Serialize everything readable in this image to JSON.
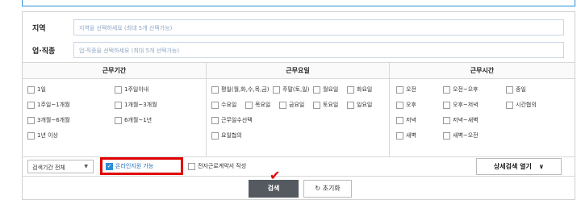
{
  "region": {
    "label": "지역",
    "placeholder": "지역을 선택하세요 (최대 5개 선택가능)"
  },
  "job": {
    "label": "업·직종",
    "placeholder": "업·직종을 선택하세요 (최대 5개 선택가능)"
  },
  "period": {
    "title": "근무기간",
    "options": [
      "1일",
      "1주일이내",
      "1주일~1개월",
      "1개월~3개월",
      "3개월~6개월",
      "6개월~1년",
      "1년 이상"
    ]
  },
  "days": {
    "title": "근무요일",
    "options": [
      "평일(월,화,수,목,금)",
      "주말(토,일)",
      "월요일",
      "화요일",
      "수요일",
      "목요일",
      "금요일",
      "토요일",
      "일요일",
      "근무일수선택",
      "요일협의"
    ]
  },
  "time": {
    "title": "근무시간",
    "options": [
      "오전",
      "오전~오후",
      "종일",
      "오후",
      "오후~저녁",
      "시간협의",
      "저녁",
      "저녁~새벽",
      "새벽",
      "새벽~오전"
    ]
  },
  "filters": {
    "period_select": "검색기간 전체",
    "online": "온라인지원 가능",
    "contract": "전자근로계약서 작성",
    "detail": "상세검색 열기"
  },
  "actions": {
    "search": "검색",
    "reset": "초기화"
  },
  "colors": {
    "highlight": "#e10000",
    "accent": "#2a8fd8",
    "search_bg": "#555a60"
  }
}
